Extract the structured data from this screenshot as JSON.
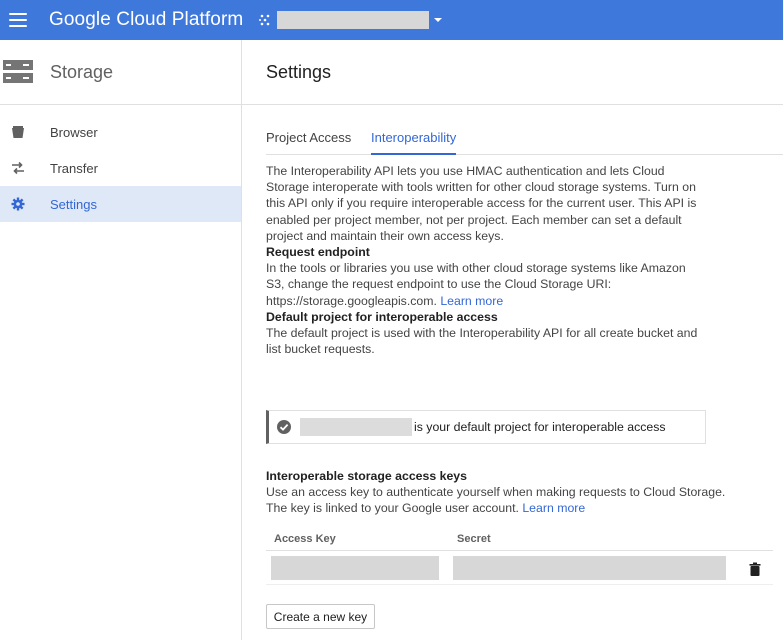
{
  "topbar": {
    "brand": "Google Cloud Platform",
    "menu_icon": "hamburger-menu-icon",
    "project_icon": "project-dots-icon",
    "project_caret_icon": "caret-down-icon",
    "bg_color": "#3f78db"
  },
  "sidebar": {
    "title": "Storage",
    "title_icon": "storage-icon",
    "items": [
      {
        "label": "Browser",
        "icon": "bucket-icon",
        "active": false
      },
      {
        "label": "Transfer",
        "icon": "transfer-arrows-icon",
        "active": false
      },
      {
        "label": "Settings",
        "icon": "gear-icon",
        "active": true
      }
    ]
  },
  "main": {
    "title": "Settings",
    "tabs": [
      {
        "label": "Project Access",
        "active": false
      },
      {
        "label": "Interoperability",
        "active": true
      }
    ],
    "intro": "The Interoperability API lets you use HMAC authentication and lets Cloud Storage interoperate with tools written for other cloud storage systems. Turn on this API only if you require interoperable access for the current user. This API is enabled per project member, not per project. Each member can set a default project and maintain their own access keys.",
    "request_endpoint": {
      "heading": "Request endpoint",
      "text": "In the tools or libraries you use with other cloud storage systems like Amazon S3, change the request endpoint to use the Cloud Storage URI: https://storage.googleapis.com.",
      "link": "Learn more"
    },
    "default_project": {
      "heading": "Default project for interoperable access",
      "text": "The default project is used with the Interoperability API for all create bucket and list bucket requests.",
      "notice": "is your default project for interoperable access",
      "notice_icon": "check-circle-icon"
    },
    "keys": {
      "heading": "Interoperable storage access keys",
      "text": "Use an access key to authenticate yourself when making requests to Cloud Storage. The key is linked to your Google user account.",
      "link": "Learn more",
      "columns": [
        "Access Key",
        "Secret"
      ],
      "delete_icon": "trash-icon",
      "create_button": "Create a new key"
    }
  },
  "colors": {
    "accent": "#3367d6",
    "active_nav_bg": "#dfe8f7"
  }
}
